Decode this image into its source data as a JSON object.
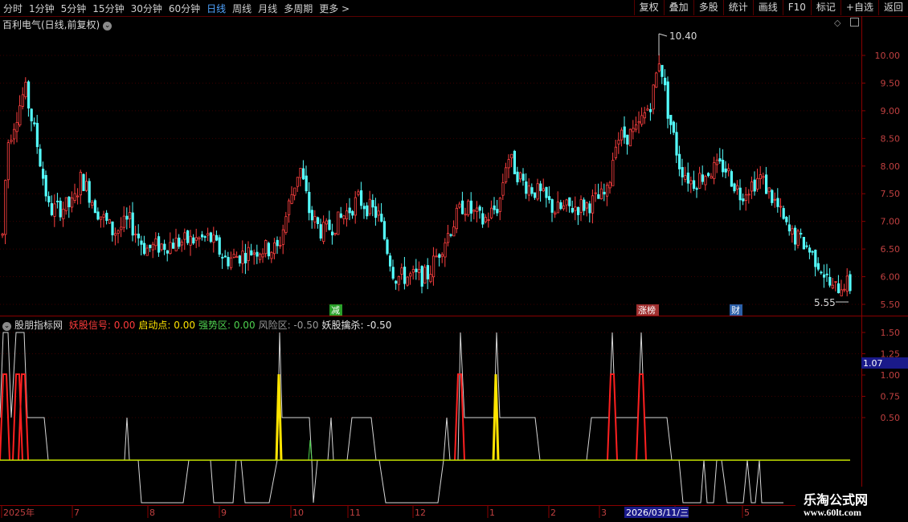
{
  "toolbar": {
    "periods": [
      "分时",
      "1分钟",
      "5分钟",
      "15分钟",
      "30分钟",
      "60分钟",
      "日线",
      "周线",
      "月线",
      "多周期",
      "更多 >"
    ],
    "active_period": "日线",
    "buttons": [
      "复权",
      "叠加",
      "多股",
      "统计",
      "画线",
      "F10",
      "标记",
      "+自选",
      "返回"
    ]
  },
  "stock": {
    "title": "百利电气(日线,前复权)"
  },
  "price_axis": {
    "labels": [
      "10.00",
      "9.50",
      "9.00",
      "8.50",
      "8.00",
      "7.50",
      "7.00",
      "6.50",
      "6.00",
      "5.50"
    ]
  },
  "annotations": {
    "high": "10.40",
    "low": "5.55",
    "markers": [
      {
        "label": "减",
        "color": "#2aa12a"
      },
      {
        "label": "涨榜",
        "color": "#a03030"
      },
      {
        "label": "财",
        "color": "#2b5fa8"
      }
    ]
  },
  "indicator": {
    "name": "股朋指标网",
    "items": [
      {
        "label": "妖股信号:",
        "value": "0.00",
        "color": "#ff3b3b"
      },
      {
        "label": "启动点:",
        "value": "0.00",
        "color": "#ffe400"
      },
      {
        "label": "强势区:",
        "value": "0.00",
        "color": "#4fd24f"
      },
      {
        "label": "风险区:",
        "value": "-0.50",
        "color": "#9a9a9a"
      },
      {
        "label": "妖股擒杀:",
        "value": "-0.50",
        "color": "#e6e6e6"
      }
    ],
    "axis_labels": [
      "1.50",
      "1.25",
      "1.00",
      "0.75",
      "0.50"
    ],
    "cursor_value": "1.07"
  },
  "date_axis": {
    "labels": [
      "2025年",
      "7",
      "8",
      "9",
      "10",
      "11",
      "12",
      "1",
      "2",
      "3",
      "4",
      "5"
    ],
    "highlight": "2026/03/11/三"
  },
  "watermark": {
    "line1": "乐淘公式网",
    "line2": "www.60lt.com"
  },
  "colors": {
    "up": "#ff4040",
    "down": "#54ffff",
    "grid": "#5a0000",
    "axis_text": "#c04040"
  }
}
